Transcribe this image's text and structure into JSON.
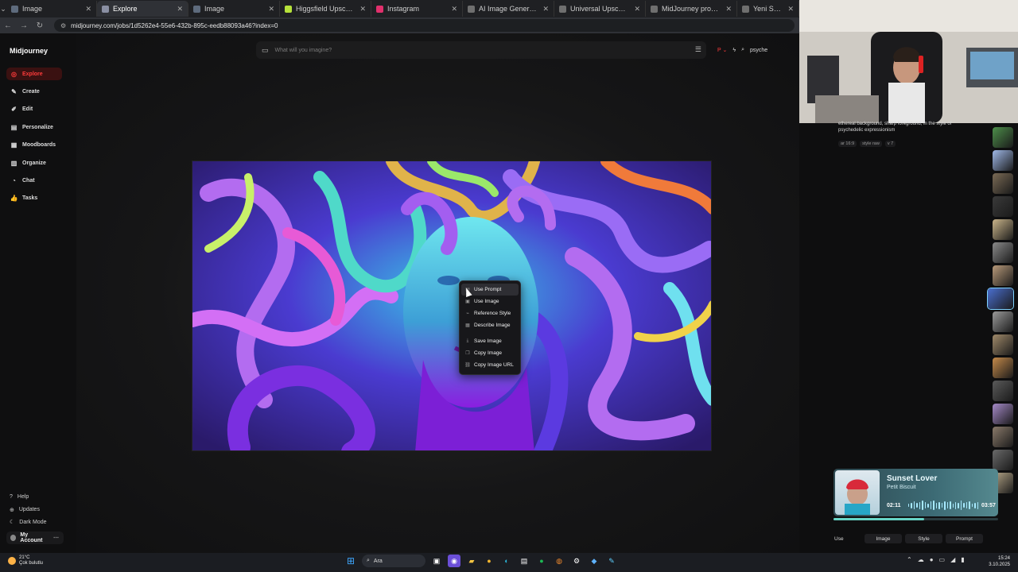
{
  "browser": {
    "tabs": [
      {
        "label": "Image",
        "favicon_color": "#5e6b7d",
        "active": false
      },
      {
        "label": "Explore",
        "favicon_color": "#8a8fa3",
        "active": true
      },
      {
        "label": "Image",
        "favicon_color": "#5e6b7d",
        "active": false
      },
      {
        "label": "Higgsfield Upscale – AI Imag",
        "favicon_color": "#b6e23b",
        "active": false
      },
      {
        "label": "Instagram",
        "favicon_color": "#e1306c",
        "active": false
      },
      {
        "label": "AI Image Generator - Create",
        "favicon_color": "#6f6f6f",
        "active": false
      },
      {
        "label": "Universal Upscaler - Leonard",
        "favicon_color": "#6f6f6f",
        "active": false
      },
      {
        "label": "MidJourney prompt oluşturm",
        "favicon_color": "#6f6f6f",
        "active": false
      },
      {
        "label": "Yeni Sekme",
        "favicon_color": "#6f6f6f",
        "active": false
      }
    ],
    "url": "midjourney.com/jobs/1d5262e4-55e6-432b-895c-eedb88093a46?index=0"
  },
  "sidebar": {
    "brand": "Midjourney",
    "items": [
      {
        "label": "Explore",
        "icon": "compass-icon",
        "active": true
      },
      {
        "label": "Create",
        "icon": "brush-icon",
        "active": false
      },
      {
        "label": "Edit",
        "icon": "pencil-icon",
        "active": false
      },
      {
        "label": "Personalize",
        "icon": "sliders-icon",
        "active": false
      },
      {
        "label": "Moodboards",
        "icon": "grid-icon",
        "active": false
      },
      {
        "label": "Organize",
        "icon": "folder-icon",
        "active": false
      },
      {
        "label": "Chat",
        "icon": "chat-icon",
        "active": false
      },
      {
        "label": "Tasks",
        "icon": "thumbs-up-icon",
        "active": false
      }
    ],
    "footer": [
      {
        "label": "Help",
        "icon": "help-icon"
      },
      {
        "label": "Updates",
        "icon": "bell-icon"
      },
      {
        "label": "Dark Mode",
        "icon": "moon-icon"
      }
    ],
    "account_label": "My Account",
    "accent_color": "#ff3b3b"
  },
  "search": {
    "placeholder": "What will you imagine?",
    "query": "psyche"
  },
  "context_menu": {
    "items": [
      {
        "label": "Use Prompt",
        "icon": "text-icon"
      },
      {
        "label": "Use Image",
        "icon": "image-icon"
      },
      {
        "label": "Reference Style",
        "icon": "link-icon"
      },
      {
        "label": "Describe Image",
        "icon": "describe-icon"
      },
      {
        "label": "Save Image",
        "icon": "download-icon"
      },
      {
        "label": "Copy Image",
        "icon": "copy-icon"
      },
      {
        "label": "Copy Image URL",
        "icon": "url-icon"
      }
    ]
  },
  "details": {
    "prompt_text": "ethereal background, sharp foreground, in the style of psychedelic expressionism",
    "tags": [
      "ar 16:9",
      "style raw",
      "v 7"
    ]
  },
  "music": {
    "song": "Sunset Lover",
    "artist": "Petit Biscuit",
    "elapsed": "02:11",
    "total": "03:57",
    "progress": 0.55
  },
  "actions": {
    "use_label": "Use",
    "chips": [
      "Image",
      "Style",
      "Prompt"
    ]
  },
  "taskbar": {
    "weather_temp": "21°C",
    "weather_desc": "Çok bulutlu",
    "search_label": "Ara",
    "time": "15:24",
    "date": "3.10.2025"
  }
}
